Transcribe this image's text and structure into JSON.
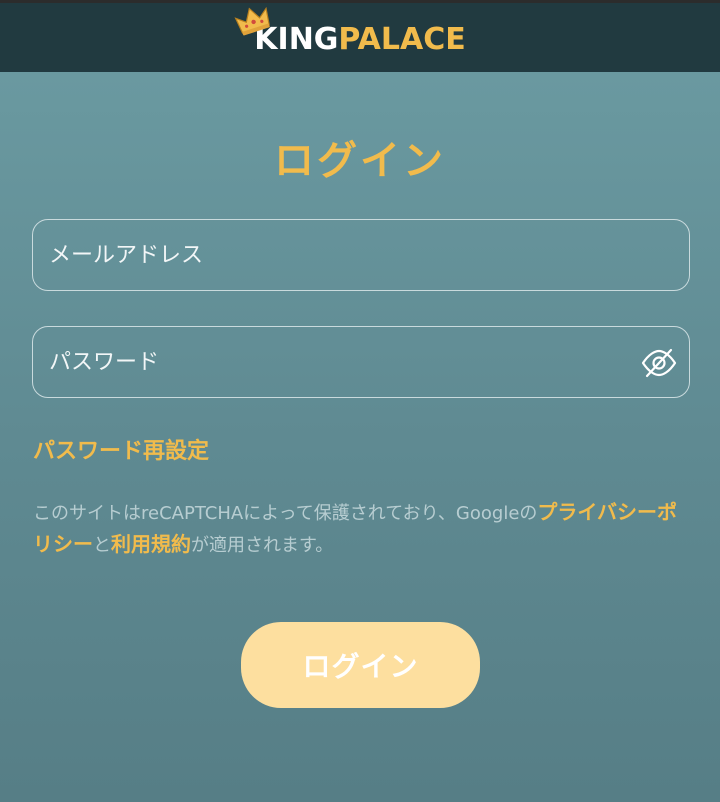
{
  "header": {
    "logo_part1": "KING",
    "logo_part2": "PALACE",
    "logo_icon": "crown-icon"
  },
  "login": {
    "title": "ログイン",
    "email_placeholder": "メールアドレス",
    "email_value": "",
    "password_placeholder": "パスワード",
    "password_value": "",
    "password_toggle_icon": "eye-off-icon",
    "reset_link": "パスワード再設定",
    "recaptcha": {
      "text_before": "このサイトはreCAPTCHAによって保護されており、Googleの",
      "privacy_link": "プライバシーポリシー",
      "text_middle": "と",
      "terms_link": "利用規約",
      "text_after": "が適用されます。"
    },
    "submit_label": "ログイン"
  },
  "colors": {
    "header_bg": "#213a40",
    "accent": "#f1bb4c",
    "button_bg": "#fddf9f",
    "page_bg_top": "#6c9ca3",
    "page_bg_bottom": "#567e86"
  }
}
